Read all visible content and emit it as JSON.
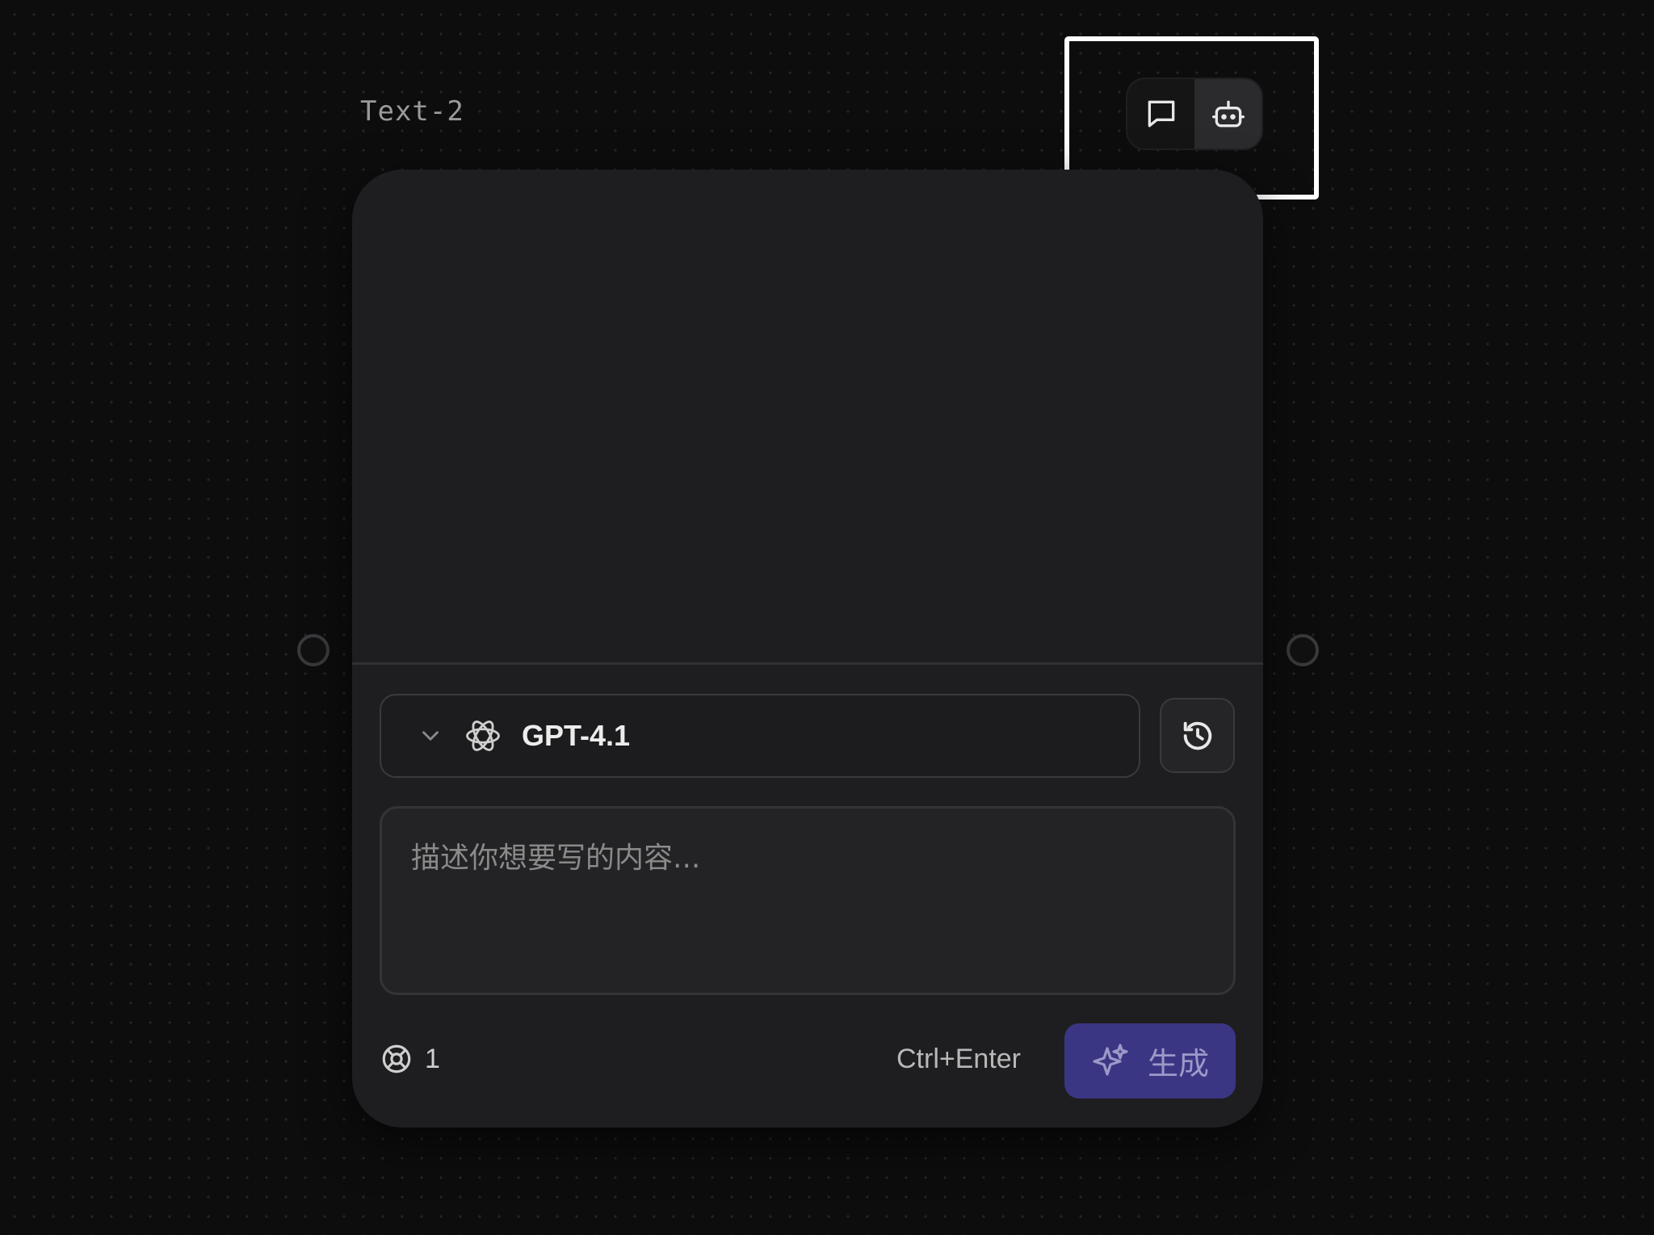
{
  "node": {
    "title": "Text-2"
  },
  "mode_toggle": {
    "items": [
      {
        "icon": "chat-bubble-icon",
        "active": false
      },
      {
        "icon": "robot-icon",
        "active": true
      }
    ]
  },
  "model": {
    "selected": "GPT-4.1",
    "icon": "openai-logo-icon"
  },
  "history": {
    "icon": "history-icon"
  },
  "prompt": {
    "value": "",
    "placeholder": "描述你想要写的内容..."
  },
  "footer": {
    "credit_icon": "credit-icon",
    "credit_count": "1",
    "shortcut": "Ctrl+Enter",
    "generate_label": "生成",
    "generate_icon": "sparkle-icon"
  },
  "colors": {
    "background": "#0d0d0e",
    "card": "#1e1e20",
    "accent": "#3b3684",
    "highlight": "#ffffff"
  }
}
